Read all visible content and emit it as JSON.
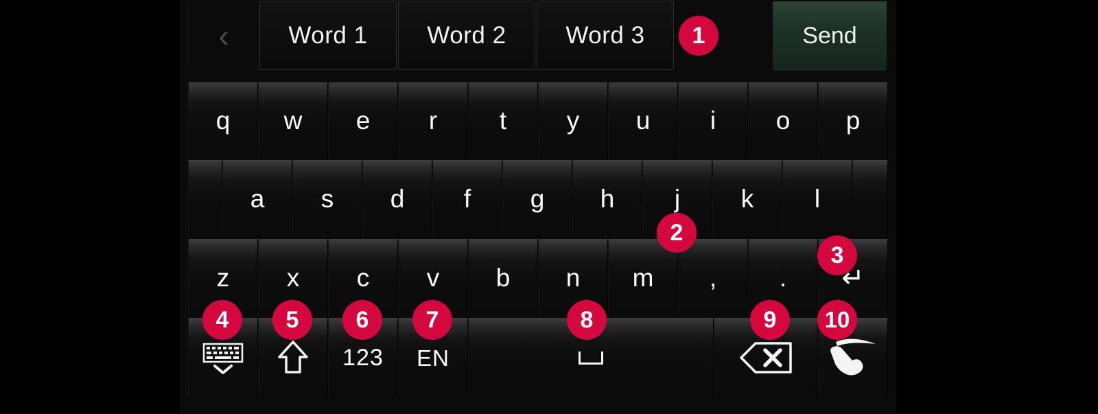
{
  "theme": {
    "page_background": "#000000",
    "panel_background": "#0b0b0b",
    "key_text": "#fdfdfd",
    "badge_color": "#d4083f",
    "badge_text": "#ffffff",
    "send_button_color": "#1e3227",
    "arrow_active_color": "#ffffff",
    "arrow_disabled_color": "#4a4a4a"
  },
  "suggestion_bar": {
    "prev_arrow": "‹",
    "next_arrow": "›",
    "words": [
      {
        "label": "Word 1"
      },
      {
        "label": "Word 2"
      },
      {
        "label": "Word 3"
      }
    ],
    "send_label": "Send"
  },
  "keyboard": {
    "row1": [
      {
        "label": "q"
      },
      {
        "label": "w"
      },
      {
        "label": "e"
      },
      {
        "label": "r"
      },
      {
        "label": "t"
      },
      {
        "label": "y"
      },
      {
        "label": "u"
      },
      {
        "label": "i"
      },
      {
        "label": "o"
      },
      {
        "label": "p"
      }
    ],
    "row2": [
      {
        "label": "a"
      },
      {
        "label": "s"
      },
      {
        "label": "d"
      },
      {
        "label": "f"
      },
      {
        "label": "g"
      },
      {
        "label": "h"
      },
      {
        "label": "j"
      },
      {
        "label": "k"
      },
      {
        "label": "l"
      }
    ],
    "row3": [
      {
        "label": "z"
      },
      {
        "label": "x"
      },
      {
        "label": "c"
      },
      {
        "label": "v"
      },
      {
        "label": "b"
      },
      {
        "label": "n"
      },
      {
        "label": "m"
      },
      {
        "label": ","
      },
      {
        "label": "."
      },
      {
        "label": "↵",
        "name": "enter-key",
        "icon": "enter-icon"
      }
    ],
    "row4": [
      {
        "label": "",
        "name": "hide-keyboard-key",
        "icon": "keyboard-down-icon"
      },
      {
        "label": "",
        "name": "shift-key",
        "icon": "shift-arrow-icon"
      },
      {
        "label": "123",
        "name": "numbers-key"
      },
      {
        "label": "EN",
        "name": "language-key"
      },
      {
        "label": "",
        "name": "space-key",
        "icon": "space-icon"
      },
      {
        "label": "",
        "name": "backspace-key",
        "icon": "backspace-icon"
      },
      {
        "label": "",
        "name": "handwriting-key",
        "icon": "handwriting-icon"
      }
    ]
  },
  "badges": [
    {
      "number": "1",
      "target": "suggestion-next-arrow"
    },
    {
      "number": "2",
      "target": "key-j"
    },
    {
      "number": "3",
      "target": "enter-key"
    },
    {
      "number": "4",
      "target": "hide-keyboard-key"
    },
    {
      "number": "5",
      "target": "shift-key"
    },
    {
      "number": "6",
      "target": "numbers-key"
    },
    {
      "number": "7",
      "target": "language-key"
    },
    {
      "number": "8",
      "target": "space-key"
    },
    {
      "number": "9",
      "target": "backspace-key"
    },
    {
      "number": "10",
      "target": "handwriting-key"
    }
  ]
}
